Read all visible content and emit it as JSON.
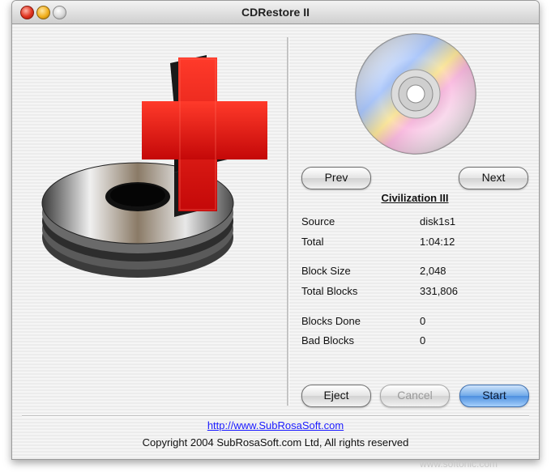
{
  "window": {
    "title": "CDRestore II"
  },
  "nav": {
    "prev_label": "Prev",
    "next_label": "Next"
  },
  "disc": {
    "name": "Civilization III"
  },
  "info": {
    "source_label": "Source",
    "source_value": "disk1s1",
    "total_label": "Total",
    "total_value": "1:04:12",
    "block_size_label": "Block Size",
    "block_size_value": "2,048",
    "total_blocks_label": "Total Blocks",
    "total_blocks_value": "331,806",
    "blocks_done_label": "Blocks Done",
    "blocks_done_value": "0",
    "bad_blocks_label": "Bad Blocks",
    "bad_blocks_value": "0"
  },
  "actions": {
    "eject_label": "Eject",
    "cancel_label": "Cancel",
    "start_label": "Start"
  },
  "footer": {
    "url": "http://www.SubRosaSoft.com",
    "copyright": "Copyright 2004 SubRosaSoft.com Ltd, All rights reserved"
  },
  "watermark": "www.softonic.com",
  "icons": {
    "app_logo": "cd-stack-with-red-cross-icon",
    "disc": "cd-disc-icon"
  },
  "colors": {
    "cross_red": "#e01010",
    "link_blue": "#1a1aff",
    "primary_button": "#4d8fe0"
  }
}
